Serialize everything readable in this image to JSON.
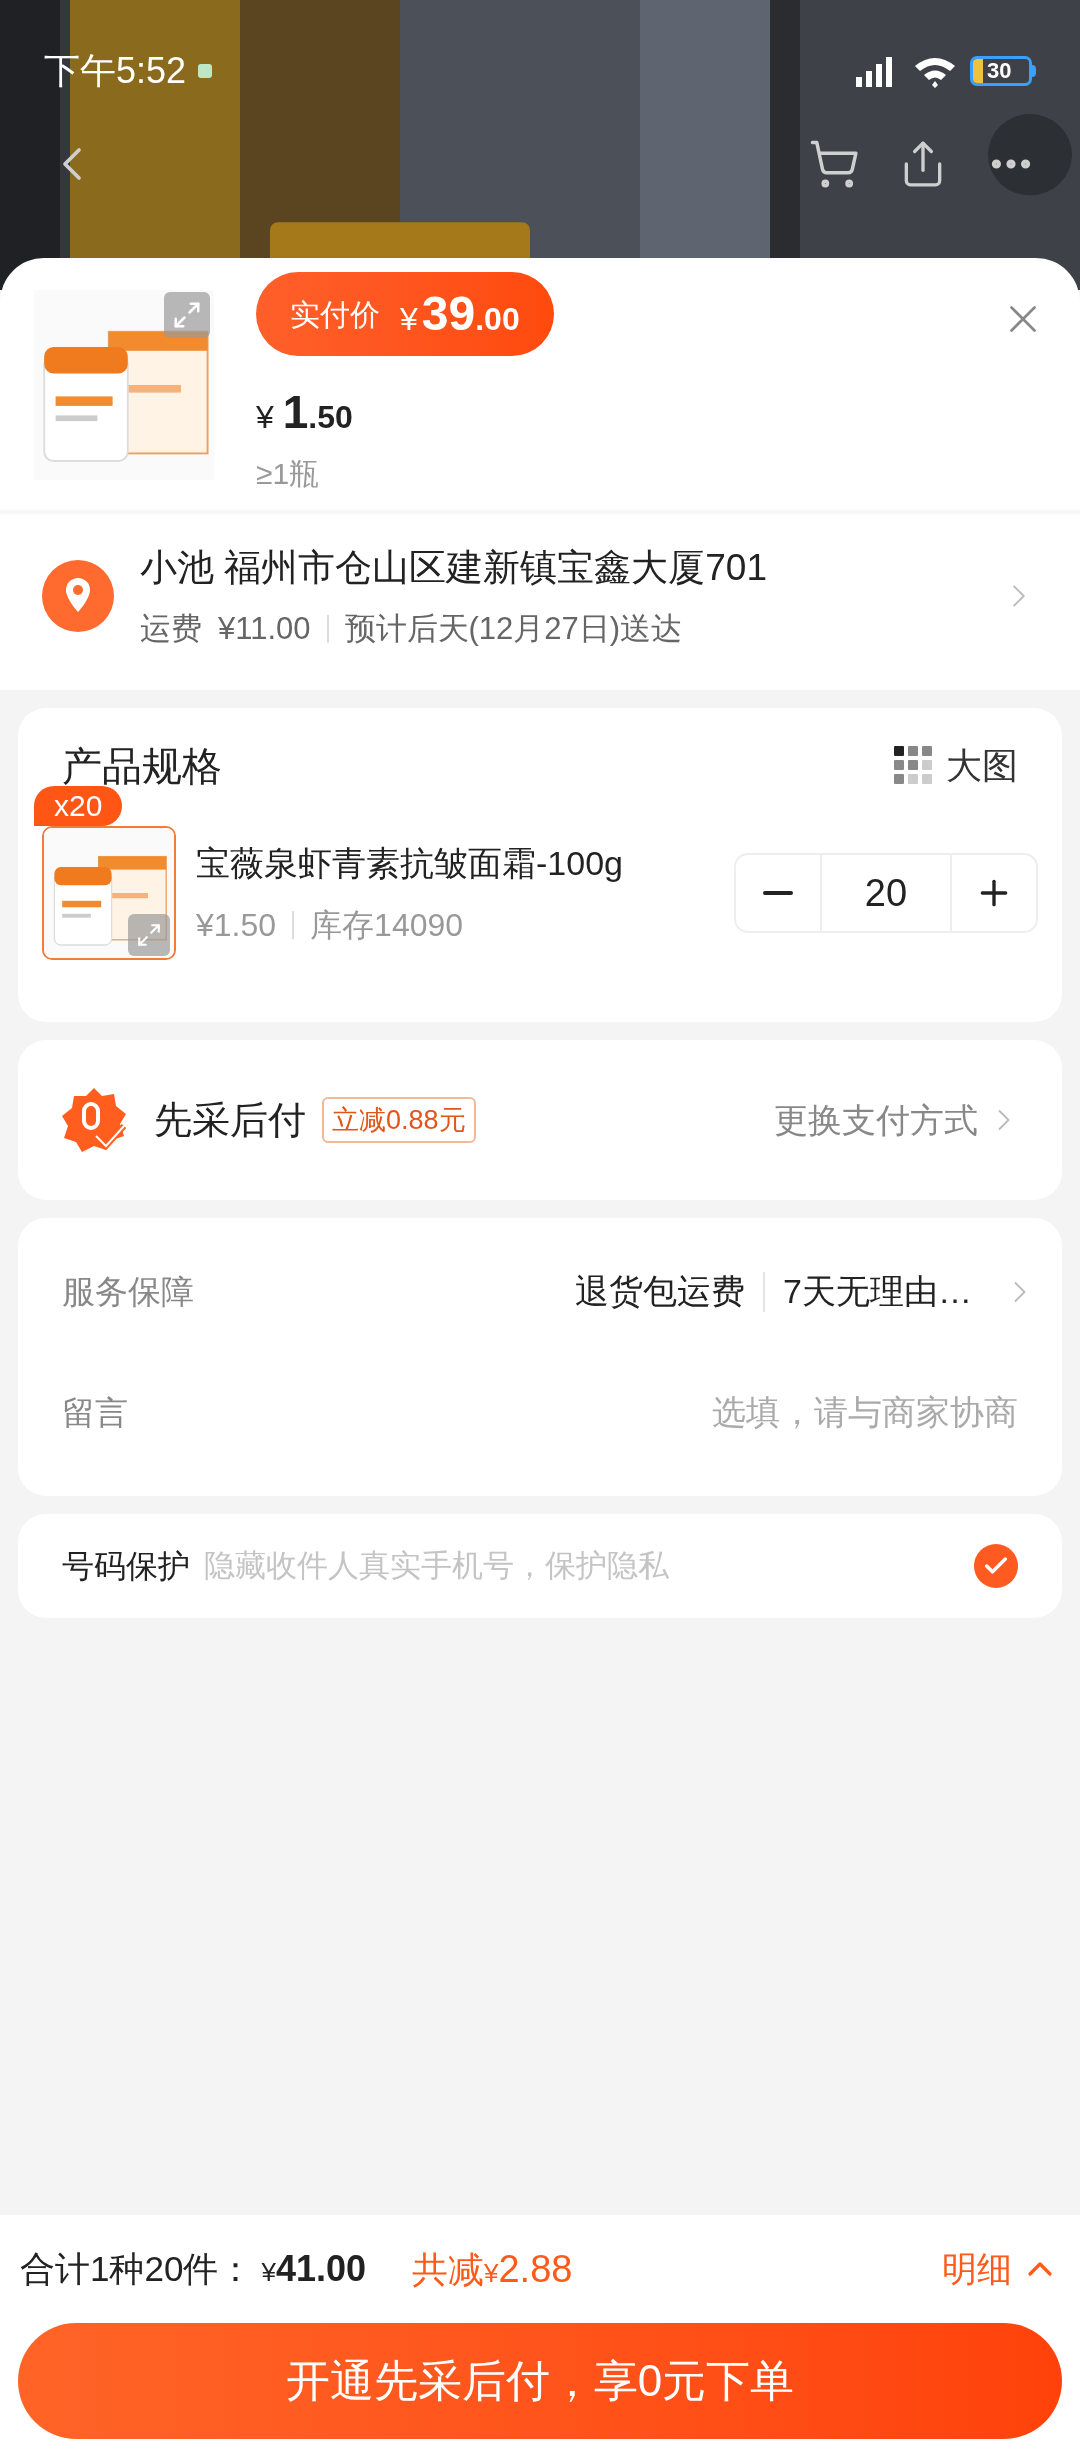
{
  "status_bar": {
    "time": "下午5:52",
    "battery": "30"
  },
  "header": {
    "price_label": "实付价",
    "price_currency": "¥",
    "price_int": "39",
    "price_dec": ".00",
    "unit_currency": "¥",
    "unit_int": "1",
    "unit_dec": ".50",
    "min_qty": "≥1瓶"
  },
  "address": {
    "name": "小池",
    "address": "福州市仓山区建新镇宝鑫大厦701",
    "shipping_label": "运费",
    "shipping_fee": "¥11.00",
    "delivery": "预计后天(12月27日)送达"
  },
  "spec": {
    "title": "产品规格",
    "view_toggle": "大图",
    "item": {
      "badge": "x20",
      "name": "宝薇泉虾青素抗皱面霜-100g",
      "price": "¥1.50",
      "stock": "库存14090",
      "quantity": "20"
    }
  },
  "payment": {
    "title": "先采后付",
    "discount": "立减0.88元",
    "change": "更换支付方式"
  },
  "service": {
    "label": "服务保障",
    "tags": [
      "退货包运费",
      "7天无理由…"
    ]
  },
  "message": {
    "label": "留言",
    "placeholder": "选填，请与商家协商"
  },
  "phone_protection": {
    "label": "号码保护",
    "hint": "隐藏收件人真实手机号，保护隐私",
    "checked": true
  },
  "footer": {
    "total_label": "合计1种20件：",
    "total_currency": "¥",
    "total": "41.00",
    "discount_label": "共减",
    "discount_currency": "¥",
    "discount": "2.88",
    "details": "明细",
    "submit": "开通先采后付，享0元下单"
  }
}
